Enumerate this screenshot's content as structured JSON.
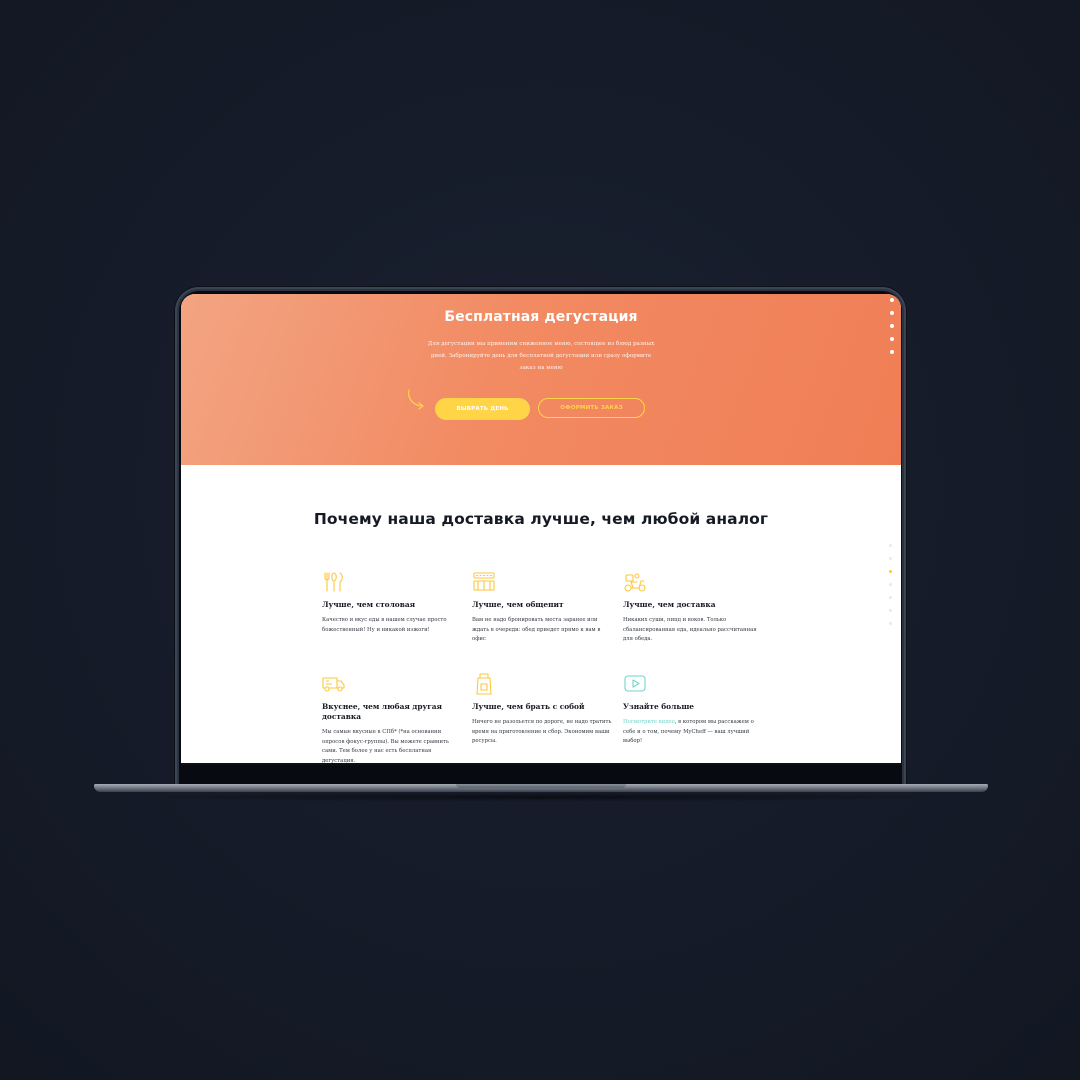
{
  "hero": {
    "title": "Бесплатная дегустация",
    "description": "Для дегустации мы применим сниженное меню, состоящее из блюд разных дней. Забронируйте день для бесплатной дегустации или сразу оформите заказ на меню",
    "primary_button": "ВЫБРАТЬ ДЕНЬ",
    "secondary_button": "ОФОРМИТЬ ЗАКАЗ",
    "nav_dots": 5
  },
  "features": {
    "title": "Почему наша доставка лучше, чем любой аналог",
    "items": [
      {
        "icon": "cutlery-icon",
        "title": "Лучше, чем столовая",
        "text": "Качество и вкус еды в нашем случае просто божественный! Ну и никакой изжоги!"
      },
      {
        "icon": "pizza-stack-icon",
        "title": "Лучше, чем общепит",
        "text": "Вам не надо бронировать места заранее или ждать в очереди: обед приедет прямо к вам в офис"
      },
      {
        "icon": "delivery-scooter-icon",
        "title": "Лучше, чем доставка",
        "text": "Никаких суши, пицц и воков. Только сбалансированная еда, идеально рассчитанная для обеда."
      },
      {
        "icon": "delivery-van-icon",
        "title": "Вкуснее, чем любая другая доставка",
        "text": "Мы самые вкусные в СПб* (*на основании опросов фокус-группы). Вы можете сравнить сами. Тем более у нас есть бесплатная дегустация."
      },
      {
        "icon": "food-package-icon",
        "title": "Лучше, чем брать с собой",
        "text": "Ничего не разольется по дороге, не надо тратить время на приготовление и сбор. Экономим ваши ресурсы."
      },
      {
        "icon": "play-video-icon",
        "title": "Узнайте больше",
        "link": "Посмотрите видео",
        "text": ", в котором мы расскажем о себе и о том, почему MyCheff — ваш лучший выбор!"
      }
    ],
    "side_dots": 7,
    "active_side_dot": 2
  },
  "colors": {
    "accent": "#ffd447",
    "hero_start": "#f3a482",
    "hero_end": "#f07e55",
    "link": "#6fd4cd",
    "background": "#141a27"
  }
}
